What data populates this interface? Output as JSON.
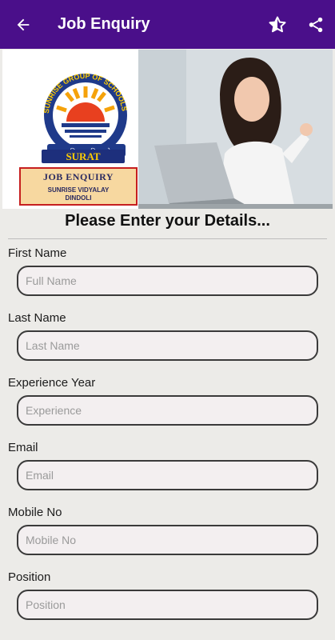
{
  "appbar": {
    "title": "Job Enquiry",
    "back_icon": "arrow-back-icon",
    "star_icon": "star-half-icon",
    "share_icon": "share-icon",
    "color": "#4a0f8a"
  },
  "banner": {
    "logo_arc_text": "SUNRISE GROUP OF SCHOOLS",
    "logo_motto": "॥सा विद्या या विमुक्तये॥",
    "city": "SURAT",
    "box_title": "JOB ENQUIRY",
    "box_sub1": "SUNRISE VIDYALAY",
    "box_sub2": "DINDOLI"
  },
  "form": {
    "heading": "Please Enter your Details...",
    "fields": [
      {
        "label": "First Name",
        "placeholder": "Full Name"
      },
      {
        "label": "Last Name",
        "placeholder": "Last Name"
      },
      {
        "label": "Experience Year",
        "placeholder": "Experience"
      },
      {
        "label": "Email",
        "placeholder": "Email"
      },
      {
        "label": "Mobile No",
        "placeholder": "Mobile No"
      },
      {
        "label": "Position",
        "placeholder": "Position"
      }
    ]
  }
}
